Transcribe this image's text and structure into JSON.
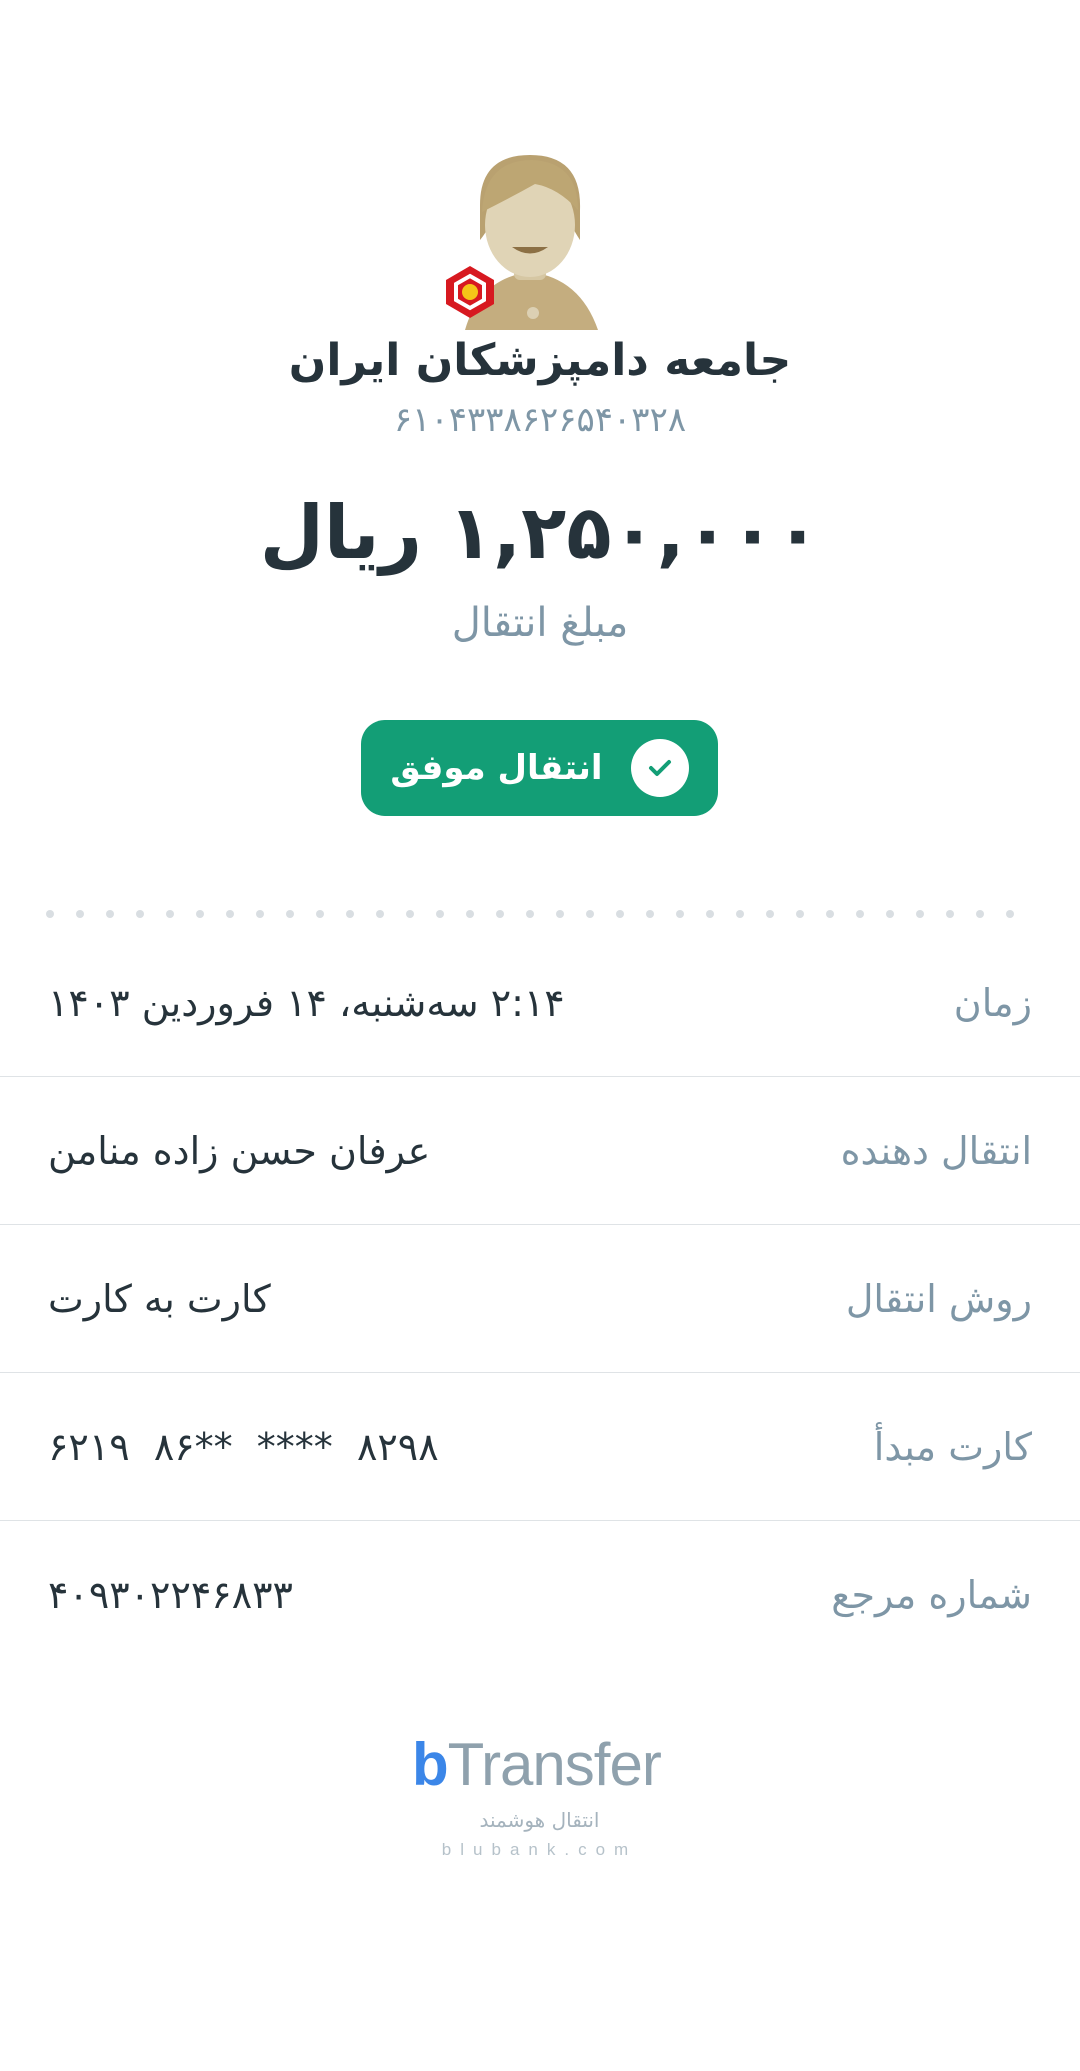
{
  "recipient": {
    "name": "جامعه دامپزشکان ایران",
    "card_number": "۶۱۰۴۳۳۸۶۲۶۵۴۰۳۲۸",
    "avatar_icon": "person-avatar-icon",
    "bank_icon": "bank-mellat-logo-icon"
  },
  "transfer": {
    "amount": "۱,۲۵۰,۰۰۰ ریال",
    "amount_label": "مبلغ انتقال",
    "status_label": "انتقال موفق",
    "status_icon": "check-icon",
    "status_color": "#139e76"
  },
  "details": [
    {
      "label": "زمان",
      "value": "۲:۱۴ سه‌شنبه، ۱۴ فروردین ۱۴۰۳"
    },
    {
      "label": "انتقال دهنده",
      "value": "عرفان حسن زاده منامن"
    },
    {
      "label": "روش انتقال",
      "value": "کارت به کارت"
    },
    {
      "label": "کارت مبدأ",
      "value": "۸۲۹۸  ****  **۸۶  ۶۲۱۹"
    },
    {
      "label": "شماره مرجع",
      "value": "۴۰۹۳۰۲۲۴۶۸۳۳"
    }
  ],
  "footer": {
    "logo_b": "b",
    "logo_text": "Transfer",
    "tagline": "انتقال هوشمند",
    "domain": "blubank.com"
  }
}
